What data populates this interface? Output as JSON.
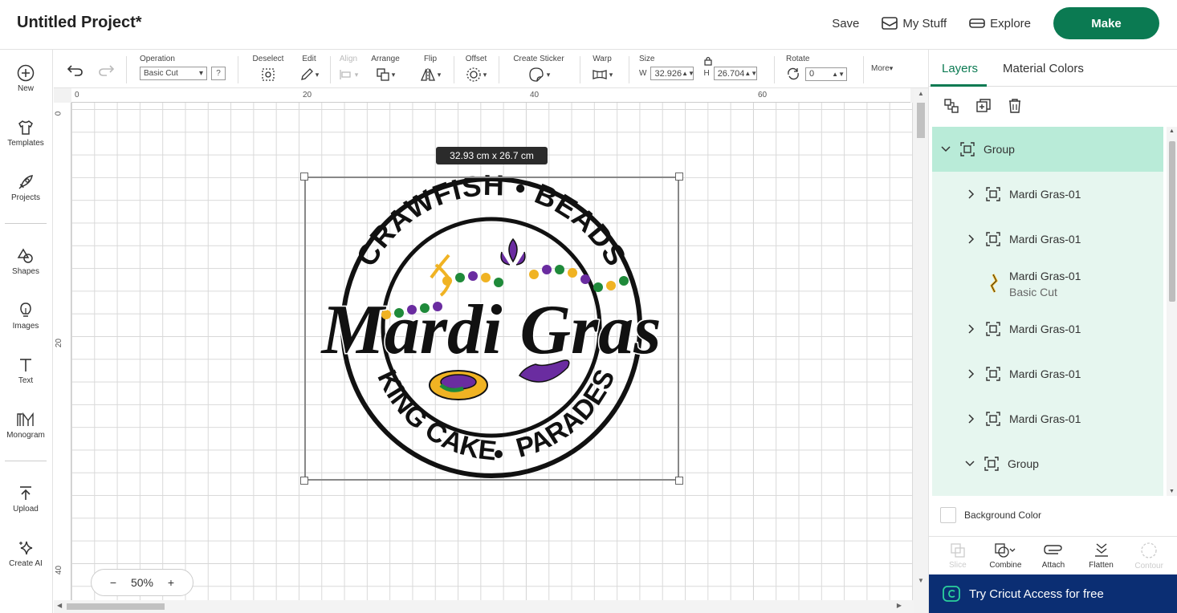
{
  "topbar": {
    "project_title": "Untitled Project*",
    "save": "Save",
    "my_stuff": "My Stuff",
    "explore": "Explore",
    "make": "Make"
  },
  "sidebar": {
    "items": [
      {
        "label": "New",
        "icon": "plus-circle-icon"
      },
      {
        "label": "Templates",
        "icon": "shirt-icon"
      },
      {
        "label": "Projects",
        "icon": "rocket-icon"
      },
      {
        "label": "Shapes",
        "icon": "shapes-icon"
      },
      {
        "label": "Images",
        "icon": "lightbulb-icon"
      },
      {
        "label": "Text",
        "icon": "text-icon"
      },
      {
        "label": "Monogram",
        "icon": "monogram-icon"
      },
      {
        "label": "Upload",
        "icon": "upload-icon"
      },
      {
        "label": "Create AI",
        "icon": "sparkle-icon"
      }
    ]
  },
  "toolbar": {
    "operation_label": "Operation",
    "operation_value": "Basic Cut",
    "help": "?",
    "deselect": "Deselect",
    "edit": "Edit",
    "align": "Align",
    "arrange": "Arrange",
    "flip": "Flip",
    "offset": "Offset",
    "create_sticker": "Create Sticker",
    "warp": "Warp",
    "size": "Size",
    "w_label": "W",
    "w_value": "32.926",
    "h_label": "H",
    "h_value": "26.704",
    "rotate": "Rotate",
    "rotate_value": "0",
    "more": "More"
  },
  "canvas": {
    "ruler_top": [
      "0",
      "20",
      "40",
      "60"
    ],
    "ruler_left": [
      "0",
      "20",
      "40"
    ],
    "size_tooltip": "32.93  cm x 26.7  cm",
    "zoom_minus": "−",
    "zoom_value": "50%",
    "zoom_plus": "+",
    "design": {
      "top_arc": "CRAWFISH • BEADS",
      "bottom_left": "KING CAKE",
      "bottom_right": "PARADES",
      "center": "Mardi Gras",
      "colors": {
        "purple": "#6a2ca0",
        "green": "#1f8a3a",
        "gold": "#f0b323",
        "black": "#111111"
      }
    }
  },
  "panel": {
    "tab_layers": "Layers",
    "tab_material": "Material Colors",
    "layers": [
      {
        "name": "Group",
        "level": 0,
        "expanded": true,
        "selected": true
      },
      {
        "name": "Mardi Gras-01",
        "level": 1,
        "expanded": false
      },
      {
        "name": "Mardi Gras-01",
        "level": 1,
        "expanded": false
      },
      {
        "name": "Mardi Gras-01",
        "sub": "Basic Cut",
        "level": 1,
        "thumb": true
      },
      {
        "name": "Mardi Gras-01",
        "level": 1,
        "expanded": false
      },
      {
        "name": "Mardi Gras-01",
        "level": 1,
        "expanded": false
      },
      {
        "name": "Mardi Gras-01",
        "level": 1,
        "expanded": false
      },
      {
        "name": "Group",
        "level": 1,
        "expanded": true
      }
    ],
    "background_color": "Background Color",
    "actions": {
      "slice": "Slice",
      "combine": "Combine",
      "attach": "Attach",
      "flatten": "Flatten",
      "contour": "Contour"
    },
    "access_banner": "Try Cricut Access for free"
  }
}
